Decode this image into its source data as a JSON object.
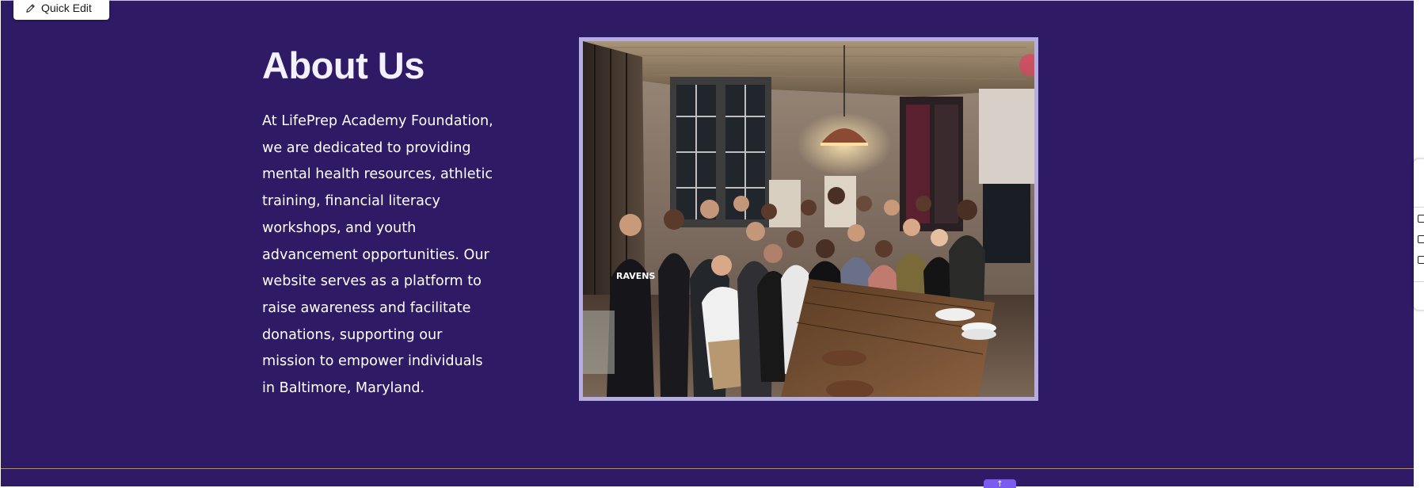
{
  "toolbar": {
    "quick_edit_label": "Quick Edit",
    "quick_edit_icon": "pencil-icon"
  },
  "about": {
    "title": "About Us",
    "body": "At LifePrep Academy Foundation, we are dedicated to providing mental health resources, athletic training, financial literacy workshops, and youth advancement opportunities. Our website serves as a platform to raise awareness and facilitate donations, supporting our mission to empower individuals in Baltimore, Maryland."
  },
  "colors": {
    "section_background": "#2f1a66",
    "photo_border": "#b5acdf",
    "divider": "#b8982a",
    "accent": "#7b5cf0"
  },
  "controls": {
    "scroll_top_icon": "arrow-up-icon",
    "side_panel_icons": [
      "text-icon",
      "layers-icon",
      "grid-icon"
    ]
  }
}
